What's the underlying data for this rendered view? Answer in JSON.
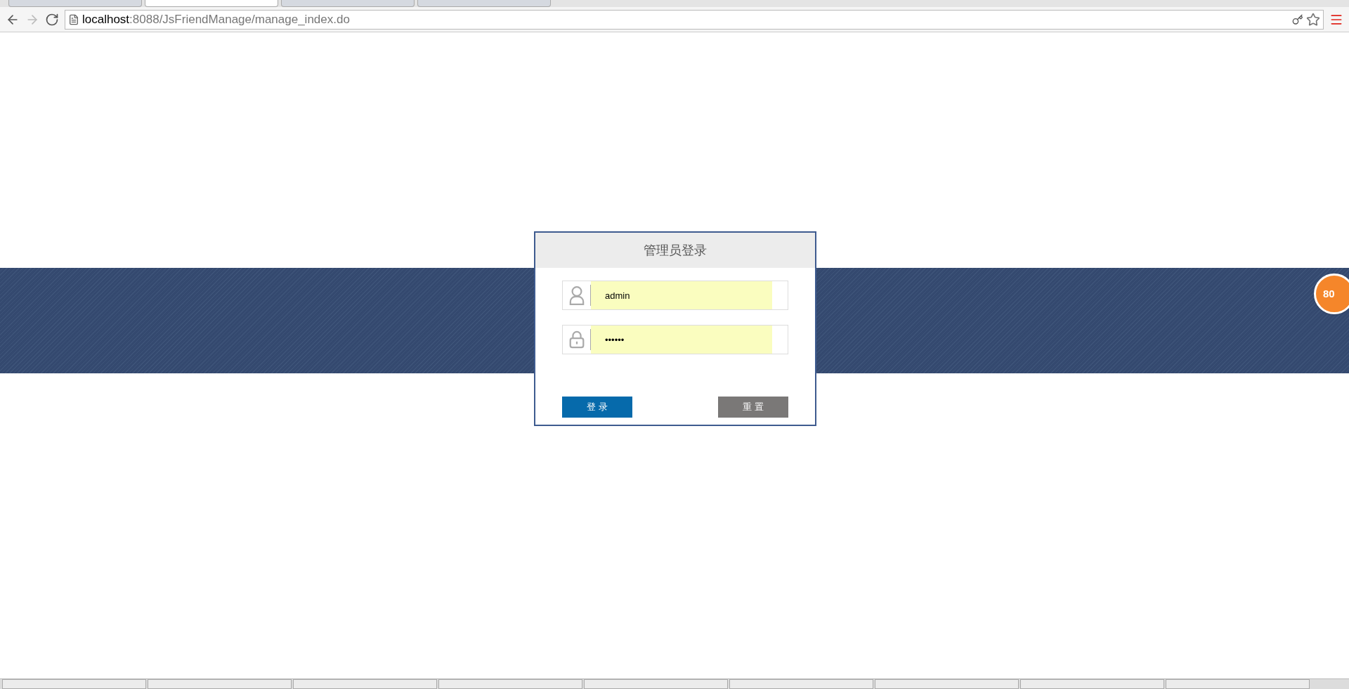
{
  "browser": {
    "tabs": [
      {
        "selected": false
      },
      {
        "selected": true
      },
      {
        "selected": false
      },
      {
        "selected": false
      }
    ],
    "address": {
      "host": "localhost",
      "rest": ":8088/JsFriendManage/manage_index.do"
    }
  },
  "login": {
    "title": "管理员登录",
    "username": "admin",
    "password": "••••••",
    "buttons": [
      {
        "label": "登 录",
        "kind": "primary"
      },
      {
        "label": "重 置",
        "kind": "secondary"
      }
    ]
  },
  "badge": {
    "text": "80"
  },
  "taskbar": {
    "items": [
      {
        "selected": false
      },
      {
        "selected": false
      },
      {
        "selected": false
      },
      {
        "selected": false
      },
      {
        "selected": false
      },
      {
        "selected": false
      },
      {
        "selected": false
      },
      {
        "selected": false
      },
      {
        "selected": false
      }
    ]
  }
}
